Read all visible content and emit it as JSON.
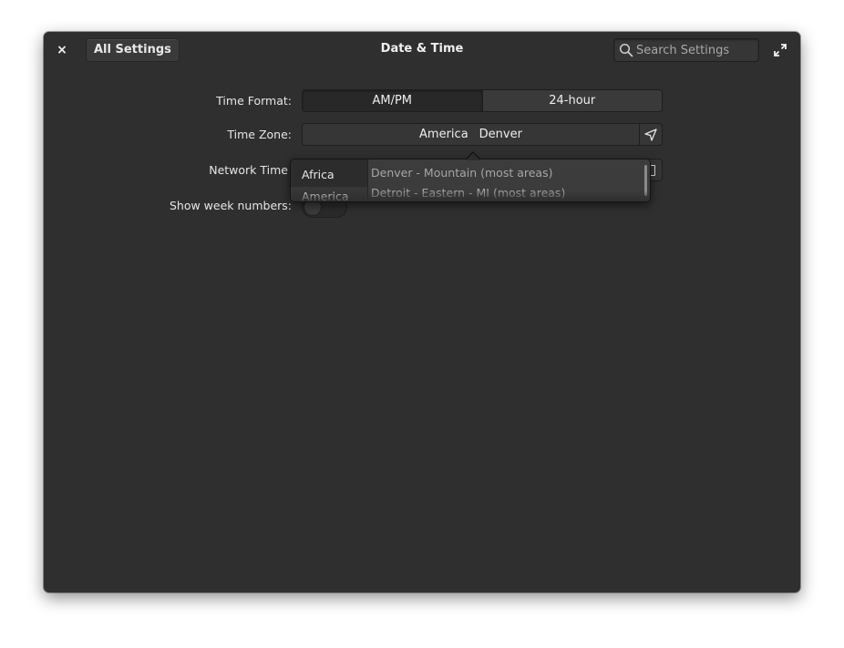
{
  "window": {
    "title": "Date & Time",
    "back_label": "All Settings",
    "close_label": "×",
    "search_placeholder": "Search Settings"
  },
  "settings": {
    "time_format": {
      "label": "Time Format:",
      "options": [
        "AM/PM",
        "24-hour"
      ],
      "selected": "AM/PM"
    },
    "time_zone": {
      "label": "Time Zone:",
      "region": "America",
      "city": "Denver"
    },
    "network_time": {
      "label": "Network Time"
    },
    "week_numbers": {
      "label": "Show week numbers:",
      "enabled": false
    }
  },
  "timezone_popover": {
    "regions": [
      "Africa",
      "America"
    ],
    "selected_region": "America",
    "cities": [
      "Denver - Mountain (most areas)",
      "Detroit - Eastern - MI (most areas)"
    ]
  },
  "icons": {
    "close": "close-icon",
    "search": "search-icon",
    "maximize": "maximize-icon",
    "locate": "location-arrow-icon"
  },
  "colors": {
    "window_bg": "#2f2f2f",
    "text": "#e6e6e6",
    "dim_text": "#a6a6a6"
  }
}
